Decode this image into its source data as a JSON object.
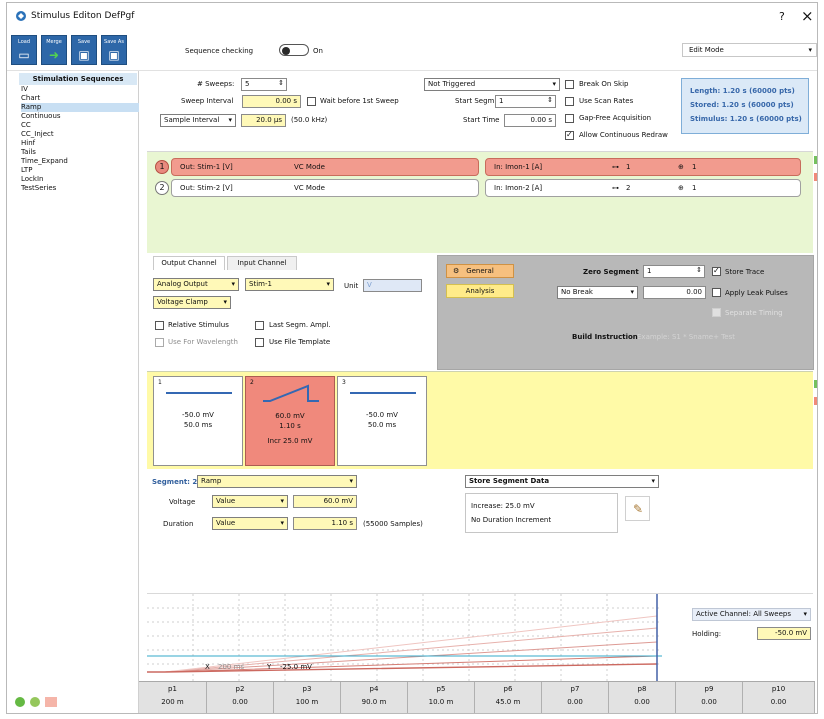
{
  "window": {
    "title": "Stimulus Editon DefPgf",
    "help_icon": "?",
    "close_icon": "×"
  },
  "toolbar": {
    "buttons": [
      {
        "label": "Load",
        "icon": "folder-icon"
      },
      {
        "label": "Merge",
        "icon": "merge-icon"
      },
      {
        "label": "Save",
        "icon": "save-icon"
      },
      {
        "label": "Save As",
        "icon": "save-as-icon"
      }
    ],
    "sequence_checking_label": "Sequence checking",
    "sequence_checking_state": "On",
    "edit_mode": "Edit Mode"
  },
  "sidebar": {
    "header": "Stimulation Sequences",
    "items": [
      "IV",
      "Chart",
      "Ramp",
      "Continuous",
      "CC",
      "CC_Inject",
      "Hinf",
      "Tails",
      "Time_Expand",
      "LTP",
      "LockIn",
      "TestSeries"
    ],
    "selected": "Ramp"
  },
  "settings": {
    "sweeps_label": "# Sweeps:",
    "sweeps_value": "5",
    "sweep_interval_label": "Sweep Interval",
    "sweep_interval_value": "0.00 s",
    "wait_before_label": "Wait before 1st Sweep",
    "sample_interval_label": "Sample Interval",
    "sample_interval_value": "20.0 µs",
    "sample_rate": "(50.0 kHz)",
    "trigger_mode": "Not Triggered",
    "start_segm_label": "Start Segm.",
    "start_segm_value": "1",
    "start_time_label": "Start Time",
    "start_time_value": "0.00 s",
    "break_on_skip": "Break On Skip",
    "use_scan_rates": "Use Scan Rates",
    "gap_free": "Gap-Free Acquisition",
    "allow_redraw": "Allow Continuous Redraw"
  },
  "stats": {
    "length": "Length: 1.20 s (60000 pts)",
    "stored": "Stored: 1.20 s (60000 pts)",
    "stimulus": "Stimulus: 1.20 s (60000 pts)"
  },
  "channels": [
    {
      "num": "1",
      "out": "Out: Stim-1 [V]",
      "mode": "VC Mode",
      "in": "In: Imon-1 [A]",
      "link": "1",
      "trace": "1"
    },
    {
      "num": "2",
      "out": "Out: Stim-2 [V]",
      "mode": "VC Mode",
      "in": "In: Imon-2 [A]",
      "link": "2",
      "trace": "1"
    }
  ],
  "channel_edit": {
    "tab_output": "Output Channel",
    "tab_input": "Input Channel",
    "analog_output": "Analog Output",
    "stim_channel": "Stim-1",
    "unit_label": "Unit",
    "unit_value": "V",
    "clamp_mode": "Voltage Clamp",
    "relative_stimulus": "Relative Stimulus",
    "last_segm_ampl": "Last Segm. Ampl.",
    "use_for_wavelength": "Use For Wavelength",
    "use_file_template": "Use File Template"
  },
  "trace_panel": {
    "general_btn": "General",
    "analysis_btn": "Analysis",
    "zero_segment_label": "Zero Segment",
    "zero_segment_value": "1",
    "store_trace": "Store Trace",
    "no_break": "No Break",
    "leak_value": "0.00",
    "apply_leak_pulses": "Apply Leak Pulses",
    "separate_timing": "Separate Timing",
    "build_instruction_label": "Build Instruction",
    "build_instruction_placeholder": "Example: S1 * Sname+ Test"
  },
  "segments": [
    {
      "num": "1",
      "voltage": "-50.0 mV",
      "duration": "50.0 ms",
      "incr": ""
    },
    {
      "num": "2",
      "voltage": "60.0 mV",
      "duration": "1.10 s",
      "incr": "Incr 25.0 mV"
    },
    {
      "num": "3",
      "voltage": "-50.0 mV",
      "duration": "50.0 ms",
      "incr": ""
    }
  ],
  "segment_editor": {
    "segment_label": "Segment: 2 of 3",
    "segment_type": "Ramp",
    "voltage_label": "Voltage",
    "voltage_mode": "Value",
    "voltage_value": "60.0 mV",
    "duration_label": "Duration",
    "duration_mode": "Value",
    "duration_value": "1.10 s",
    "samples": "(55000 Samples)",
    "store_segment_data": "Store Segment Data",
    "increase_text": "Increase: 25.0 mV",
    "no_duration_increment": "No Duration Increment"
  },
  "plot": {
    "active_channel": "Active Channel: All Sweeps",
    "holding_label": "Holding:",
    "holding_value": "-50.0 mV",
    "cursor_x": "X",
    "cursor_x_value": "200 ms",
    "cursor_y": "Y",
    "cursor_y_value": "-25.0 mV"
  },
  "parameters": [
    {
      "name": "p1",
      "value": "200 m"
    },
    {
      "name": "p2",
      "value": "0.00"
    },
    {
      "name": "p3",
      "value": "100 m"
    },
    {
      "name": "p4",
      "value": "90.0 m"
    },
    {
      "name": "p5",
      "value": "10.0 m"
    },
    {
      "name": "p6",
      "value": "45.0 m"
    },
    {
      "name": "p7",
      "value": "0.00"
    },
    {
      "name": "p8",
      "value": "0.00"
    },
    {
      "name": "p9",
      "value": "0.00"
    },
    {
      "name": "p10",
      "value": "0.00"
    }
  ]
}
